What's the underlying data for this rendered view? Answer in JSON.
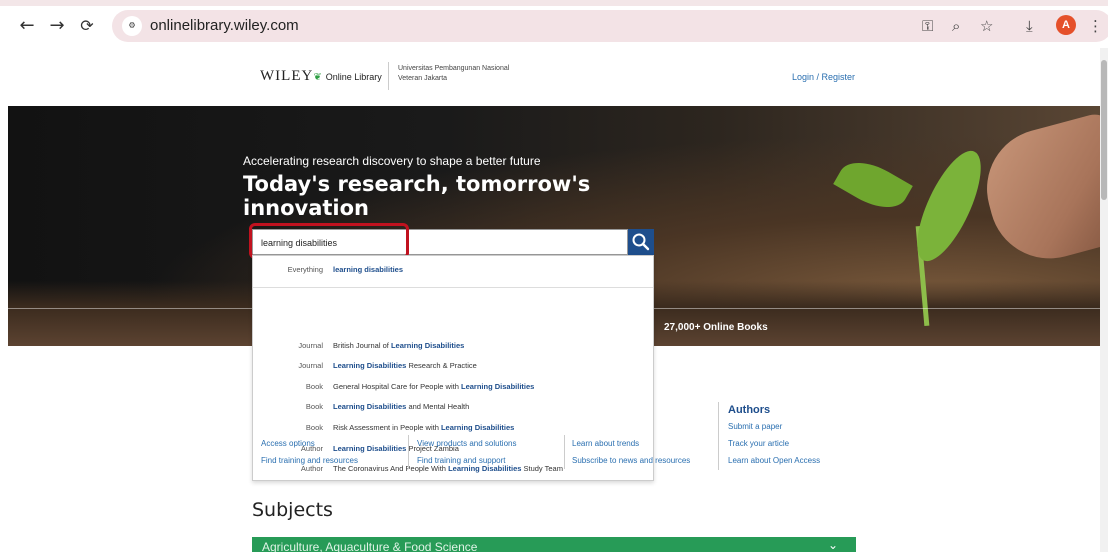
{
  "browser": {
    "url": "onlinelibrary.wiley.com",
    "avatar_letter": "A"
  },
  "header": {
    "logo_main": "WILEY",
    "logo_sub": "Online Library",
    "institution_line1": "Universitas Pembangunan Nasional",
    "institution_line2": "Veteran Jakarta",
    "login_label": "Login / Register"
  },
  "hero": {
    "tagline": "Accelerating research discovery to shape a better future",
    "headline": "Today's research, tomorrow's innovation",
    "books_label": "27,000+ Online Books"
  },
  "search": {
    "value": "learning disabilities",
    "suggestions": [
      {
        "type": "Everything",
        "pre": "",
        "bold": "learning disabilities",
        "post": ""
      },
      {
        "type": "Journal",
        "pre": "British Journal of ",
        "bold": "Learning Disabilities",
        "post": ""
      },
      {
        "type": "Journal",
        "pre": "",
        "bold": "Learning Disabilities",
        "post": " Research & Practice"
      },
      {
        "type": "Book",
        "pre": "General Hospital Care for People with ",
        "bold": "Learning Disabilities",
        "post": ""
      },
      {
        "type": "Book",
        "pre": "",
        "bold": "Learning Disabilities",
        "post": " and Mental Health"
      },
      {
        "type": "Book",
        "pre": "Risk Assessment in People with ",
        "bold": "Learning Disabilities",
        "post": ""
      },
      {
        "type": "Author",
        "pre": "",
        "bold": "Learning Disabilities",
        "post": " Project Zambia"
      },
      {
        "type": "Author",
        "pre": "The Coronavirus And People With ",
        "bold": "Learning Disabilities",
        "post": " Study Team"
      }
    ]
  },
  "links": {
    "col1": [
      "Access options",
      "Find training and resources"
    ],
    "col2": [
      "View products and solutions",
      "Find training and support"
    ],
    "col3": [
      "Learn about trends",
      "Subscribe to news and resources"
    ],
    "authors_heading": "Authors",
    "col4": [
      "Submit a paper",
      "Track your article",
      "Learn about Open Access"
    ]
  },
  "subjects": {
    "heading": "Subjects",
    "first": "Agriculture, Aquaculture & Food Science"
  }
}
